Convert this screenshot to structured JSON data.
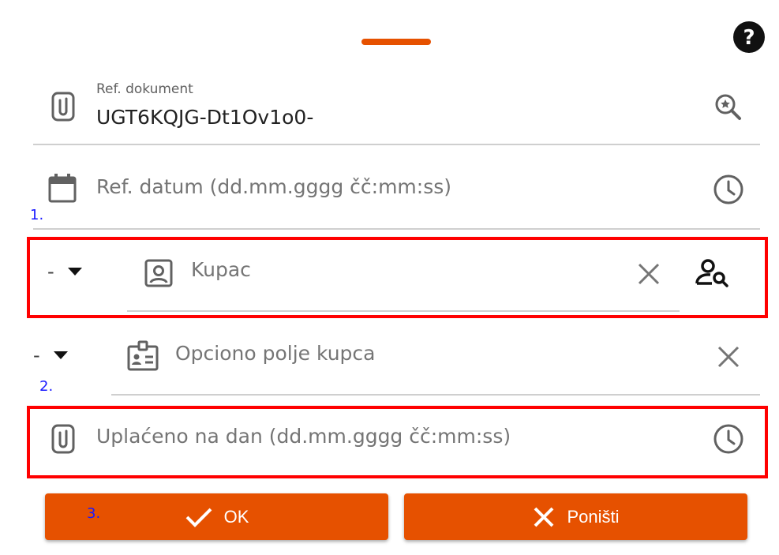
{
  "dialog": {
    "ref_dokument": {
      "label": "Ref. dokument",
      "value": "UGT6KQJG-Dt1Ov1o0-"
    },
    "ref_datum": {
      "placeholder": "Ref. datum (dd.mm.gggg čč:mm:ss)"
    },
    "kupac": {
      "prefix": "-",
      "placeholder": "Kupac"
    },
    "opciono": {
      "prefix": "-",
      "placeholder": "Opciono polje kupca"
    },
    "uplaceno": {
      "placeholder": "Uplaćeno na dan (dd.mm.gggg čč:mm:ss)"
    },
    "buttons": {
      "ok_label": "OK",
      "cancel_label": "Poništi"
    }
  },
  "annotations": {
    "a1": "1.",
    "a2": "2.",
    "a3": "3."
  },
  "colors": {
    "accent": "#e65100",
    "highlight": "#ff0000",
    "annotation": "#1a1aff"
  }
}
